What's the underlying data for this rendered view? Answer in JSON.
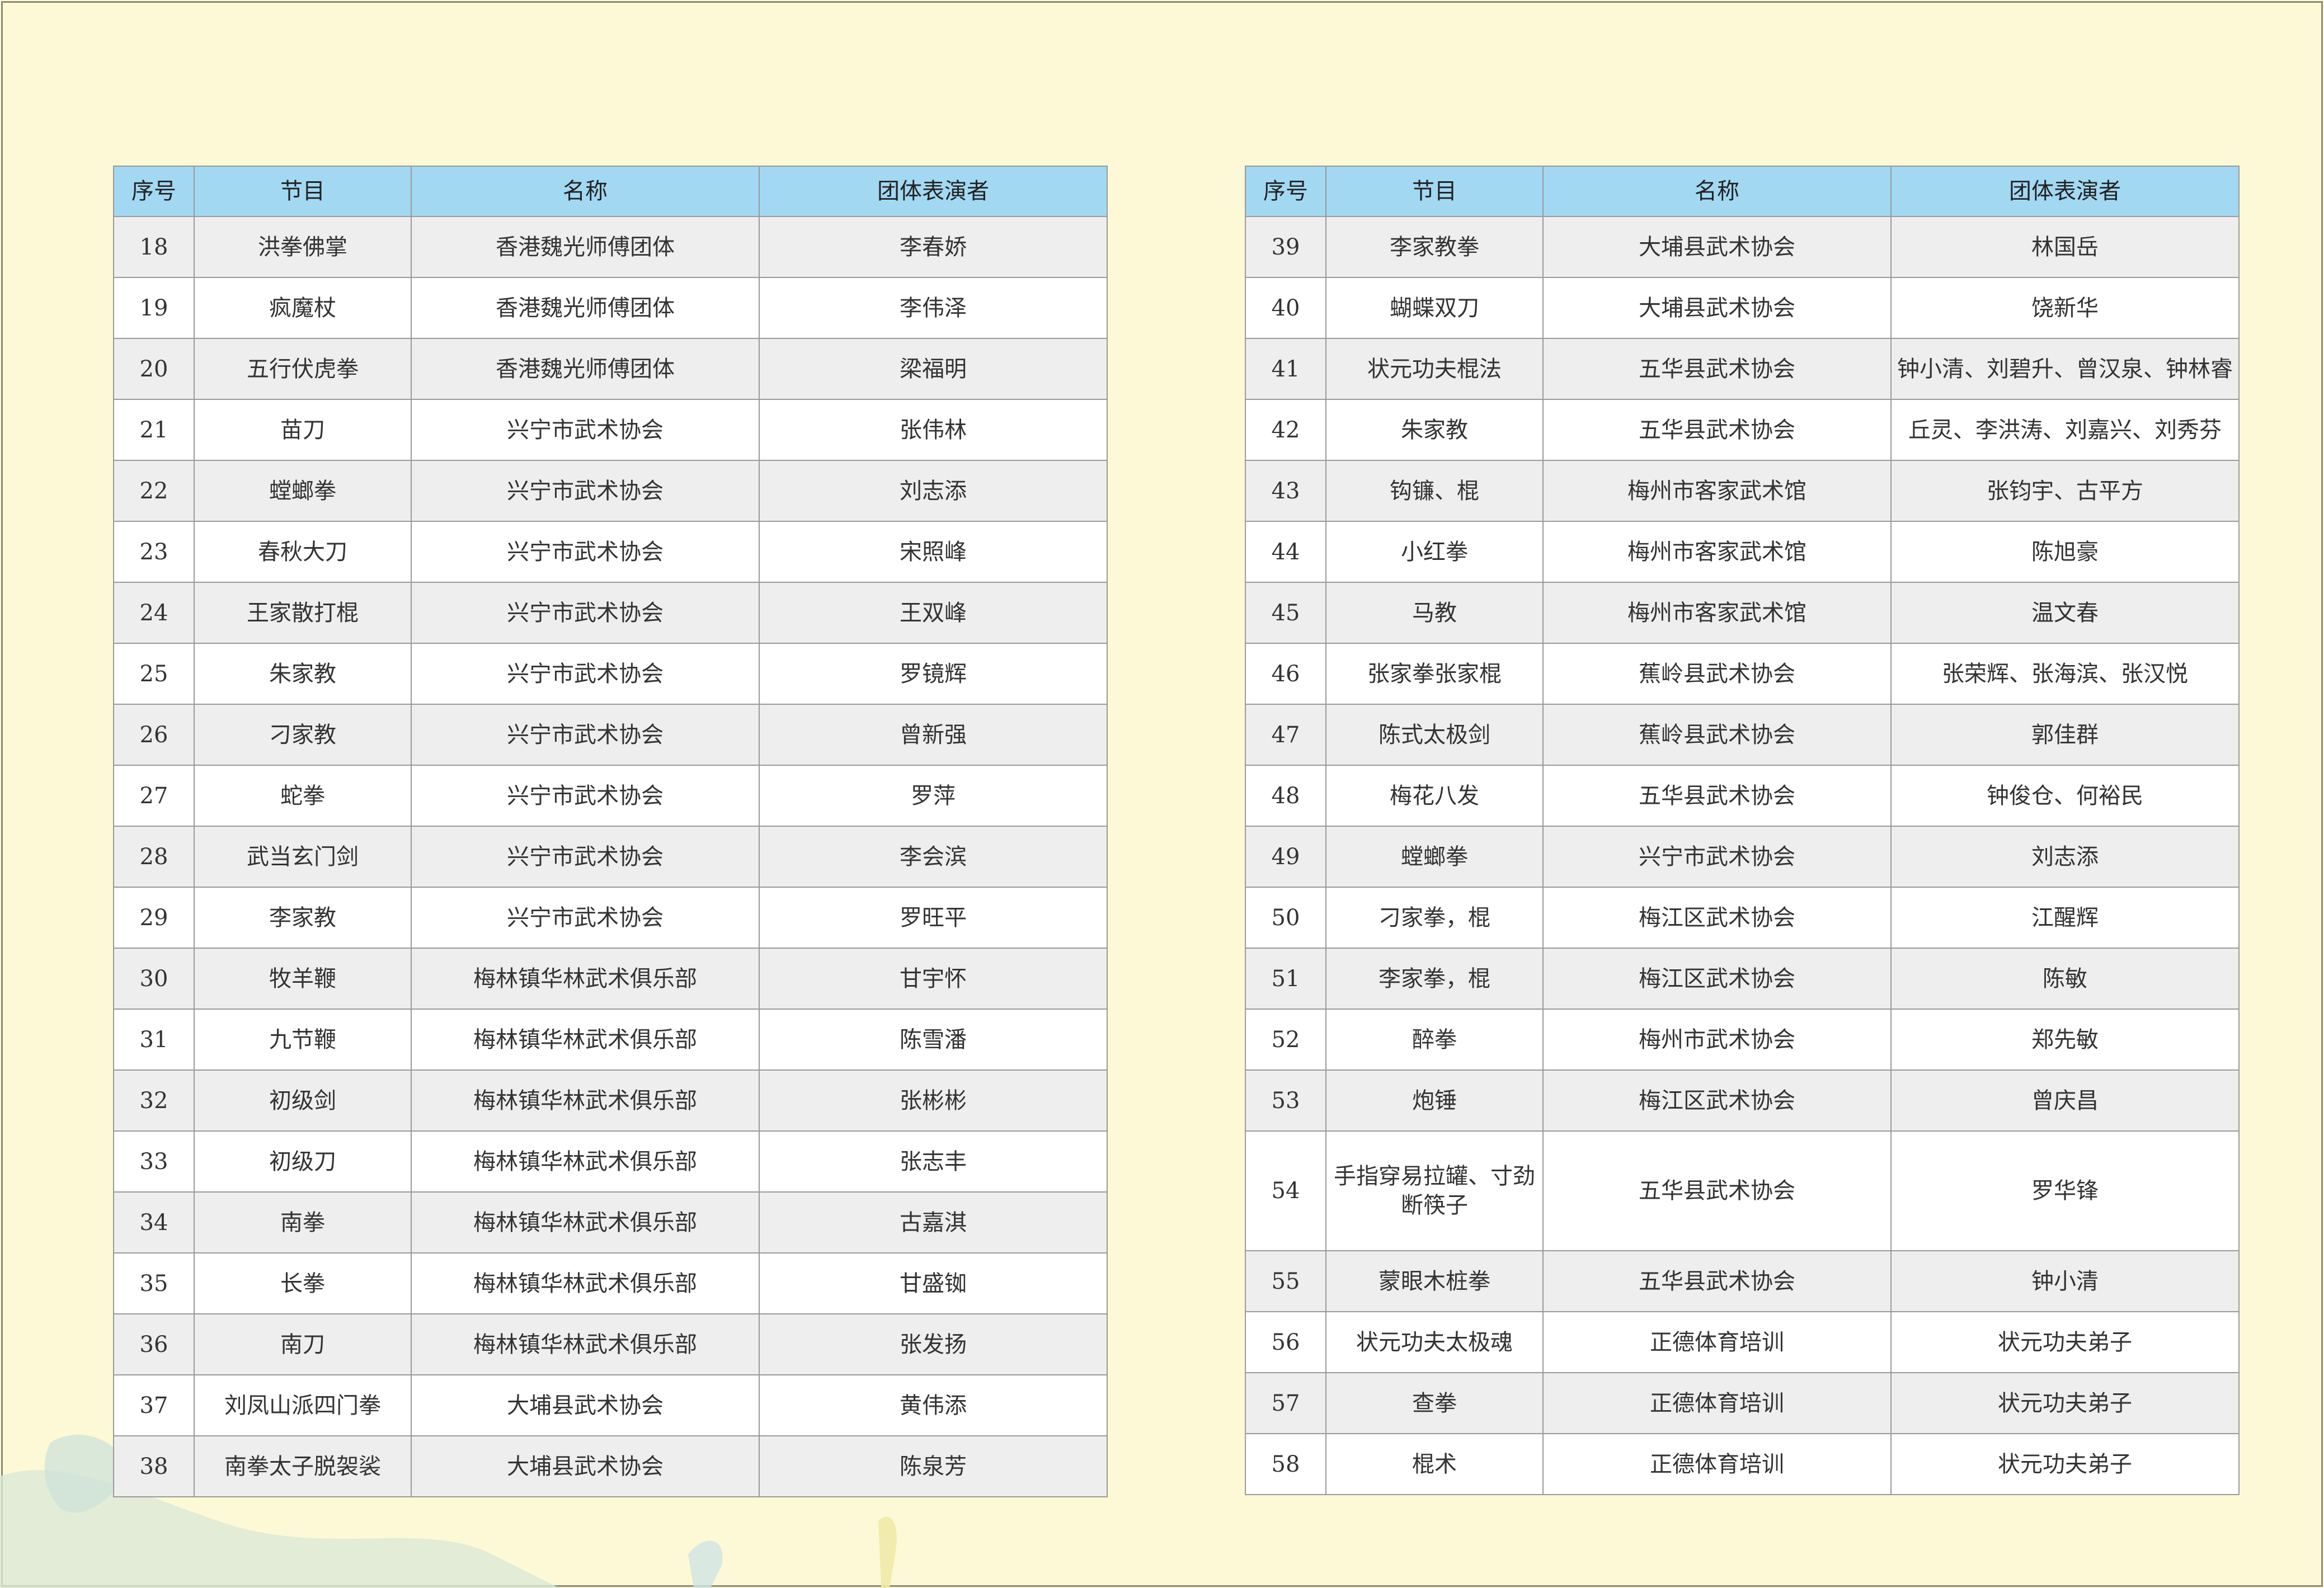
{
  "headers": [
    "序号",
    "节目",
    "名称",
    "团体表演者"
  ],
  "tables": [
    {
      "rows": [
        {
          "no": "18",
          "program": "洪拳佛掌",
          "name": "香港魏光师傅团体",
          "performers": "李春娇"
        },
        {
          "no": "19",
          "program": "疯魔杖",
          "name": "香港魏光师傅团体",
          "performers": "李伟泽"
        },
        {
          "no": "20",
          "program": "五行伏虎拳",
          "name": "香港魏光师傅团体",
          "performers": "梁福明"
        },
        {
          "no": "21",
          "program": "苗刀",
          "name": "兴宁市武术协会",
          "performers": "张伟林"
        },
        {
          "no": "22",
          "program": "螳螂拳",
          "name": "兴宁市武术协会",
          "performers": "刘志添"
        },
        {
          "no": "23",
          "program": "春秋大刀",
          "name": "兴宁市武术协会",
          "performers": "宋照峰"
        },
        {
          "no": "24",
          "program": "王家散打棍",
          "name": "兴宁市武术协会",
          "performers": "王双峰"
        },
        {
          "no": "25",
          "program": "朱家教",
          "name": "兴宁市武术协会",
          "performers": "罗镜辉"
        },
        {
          "no": "26",
          "program": "刁家教",
          "name": "兴宁市武术协会",
          "performers": "曾新强"
        },
        {
          "no": "27",
          "program": "蛇拳",
          "name": "兴宁市武术协会",
          "performers": "罗萍"
        },
        {
          "no": "28",
          "program": "武当玄门剑",
          "name": "兴宁市武术协会",
          "performers": "李会滨"
        },
        {
          "no": "29",
          "program": "李家教",
          "name": "兴宁市武术协会",
          "performers": "罗旺平"
        },
        {
          "no": "30",
          "program": "牧羊鞭",
          "name": "梅林镇华林武术俱乐部",
          "performers": "甘宇怀"
        },
        {
          "no": "31",
          "program": "九节鞭",
          "name": "梅林镇华林武术俱乐部",
          "performers": "陈雪潘"
        },
        {
          "no": "32",
          "program": "初级剑",
          "name": "梅林镇华林武术俱乐部",
          "performers": "张彬彬"
        },
        {
          "no": "33",
          "program": "初级刀",
          "name": "梅林镇华林武术俱乐部",
          "performers": "张志丰"
        },
        {
          "no": "34",
          "program": "南拳",
          "name": "梅林镇华林武术俱乐部",
          "performers": "古嘉淇"
        },
        {
          "no": "35",
          "program": "长拳",
          "name": "梅林镇华林武术俱乐部",
          "performers": "甘盛铷"
        },
        {
          "no": "36",
          "program": "南刀",
          "name": "梅林镇华林武术俱乐部",
          "performers": "张发扬"
        },
        {
          "no": "37",
          "program": "刘凤山派四门拳",
          "name": "大埔县武术协会",
          "performers": "黄伟添"
        },
        {
          "no": "38",
          "program": "南拳太子脱袈裟",
          "name": "大埔县武术协会",
          "performers": "陈泉芳"
        }
      ]
    },
    {
      "rows": [
        {
          "no": "39",
          "program": "李家教拳",
          "name": "大埔县武术协会",
          "performers": "林国岳"
        },
        {
          "no": "40",
          "program": "蝴蝶双刀",
          "name": "大埔县武术协会",
          "performers": "饶新华"
        },
        {
          "no": "41",
          "program": "状元功夫棍法",
          "name": "五华县武术协会",
          "performers": "钟小清、刘碧升、曾汉泉、钟林睿"
        },
        {
          "no": "42",
          "program": "朱家教",
          "name": "五华县武术协会",
          "performers": "丘灵、李洪涛、刘嘉兴、刘秀芬"
        },
        {
          "no": "43",
          "program": "钩镰、棍",
          "name": "梅州市客家武术馆",
          "performers": "张钧宇、古平方"
        },
        {
          "no": "44",
          "program": "小红拳",
          "name": "梅州市客家武术馆",
          "performers": "陈旭豪"
        },
        {
          "no": "45",
          "program": "马教",
          "name": "梅州市客家武术馆",
          "performers": "温文春"
        },
        {
          "no": "46",
          "program": "张家拳张家棍",
          "name": "蕉岭县武术协会",
          "performers": "张荣辉、张海滨、张汉悦"
        },
        {
          "no": "47",
          "program": "陈式太极剑",
          "name": "蕉岭县武术协会",
          "performers": "郭佳群"
        },
        {
          "no": "48",
          "program": "梅花八发",
          "name": "五华县武术协会",
          "performers": "钟俊仓、何裕民"
        },
        {
          "no": "49",
          "program": "螳螂拳",
          "name": "兴宁市武术协会",
          "performers": "刘志添"
        },
        {
          "no": "50",
          "program": "刁家拳，棍",
          "name": "梅江区武术协会",
          "performers": "江醒辉"
        },
        {
          "no": "51",
          "program": "李家拳，棍",
          "name": "梅江区武术协会",
          "performers": "陈敏"
        },
        {
          "no": "52",
          "program": "醉拳",
          "name": "梅州市武术协会",
          "performers": "郑先敏"
        },
        {
          "no": "53",
          "program": "炮锤",
          "name": "梅江区武术协会",
          "performers": "曾庆昌"
        },
        {
          "no": "54",
          "program": "手指穿易拉罐、寸劲断筷子",
          "name": "五华县武术协会",
          "performers": "罗华锋"
        },
        {
          "no": "55",
          "program": "蒙眼木桩拳",
          "name": "五华县武术协会",
          "performers": "钟小清"
        },
        {
          "no": "56",
          "program": "状元功夫太极魂",
          "name": "正德体育培训",
          "performers": "状元功夫弟子"
        },
        {
          "no": "57",
          "program": "查拳",
          "name": "正德体育培训",
          "performers": "状元功夫弟子"
        },
        {
          "no": "58",
          "program": "棍术",
          "name": "正德体育培训",
          "performers": "状元功夫弟子"
        }
      ]
    }
  ]
}
